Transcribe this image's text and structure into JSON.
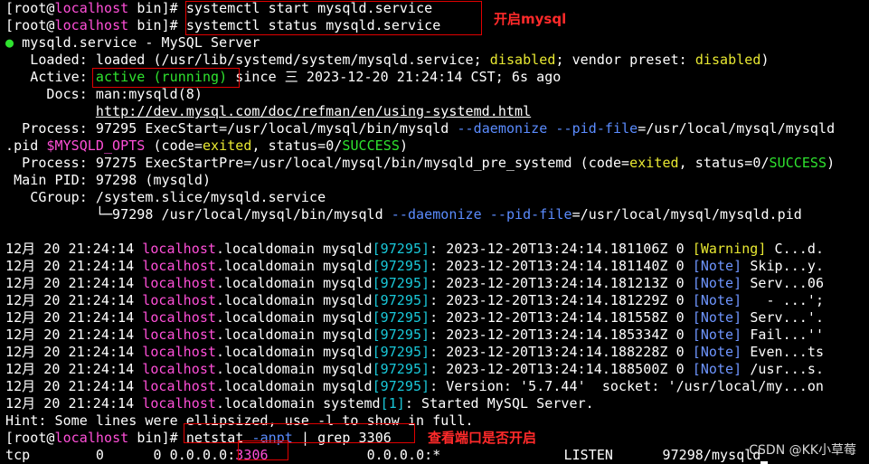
{
  "prompt": {
    "open": "[",
    "user": "root",
    "at": "@",
    "host": "localhost",
    "dir": " bin]",
    "hash": "# "
  },
  "cmd1": "systemctl start mysqld.service",
  "cmd2": "systemctl status mysqld.service",
  "status": {
    "bullet": "●",
    "title": " mysqld.service - MySQL Server",
    "loaded_label": "   Loaded: ",
    "loaded_pre": "loaded (/usr/lib/systemd/system/mysqld.service; ",
    "loaded_dis1": "disabled",
    "loaded_mid": "; vendor preset: ",
    "loaded_dis2": "disabled",
    "loaded_end": ")",
    "active_label": "   Active: ",
    "active_val": "active (running)",
    "active_since": " since 三 2023-12-20 21:24:14 CST; 6s ago",
    "docs_label": "     Docs: ",
    "docs_1": "man:mysqld(8)",
    "docs_indent": "           ",
    "docs_2": "http://dev.mysql.com/doc/refman/en/using-systemd.html",
    "proc1_a": "  Process: 97295 ExecStart=/usr/local/mysql/bin/mysqld ",
    "proc1_d": "--daemonize --pid-file",
    "proc1_b": "=/usr/local/mysql/mysqld",
    "proc1_c": ".pid ",
    "proc1_var": "$MYSQLD_OPTS",
    "proc1_code": " (code=",
    "proc1_exited": "exited",
    "proc1_st": ", status=0/",
    "proc1_succ": "SUCCESS",
    "proc1_end": ")",
    "proc2_a": "  Process: 97275 ExecStartPre=/usr/local/mysql/bin/mysqld_pre_systemd (code=",
    "proc2_exited": "exited",
    "proc2_st": ", status=0/",
    "proc2_succ": "SUCCESS",
    "proc2_end": ")",
    "mainpid": " Main PID: 97298 (mysqld)",
    "cgroup": "   CGroup: /system.slice/mysqld.service",
    "cgroup_tree_a": "           └─97298 /usr/local/mysql/bin/mysqld ",
    "cgroup_tree_d1": "--daemonize",
    "cgroup_tree_sp": " ",
    "cgroup_tree_d2": "--pid-file",
    "cgroup_tree_b": "=/usr/local/mysql/mysqld.pid"
  },
  "logs": [
    {
      "date": "12月 20 21:24:14 ",
      "host": "localhost",
      ".domain": ".localdomain",
      "proc": " mysqld",
      "pid": "[97295]",
      "msg": ": 2023-12-20T13:24:14.181106Z 0 ",
      "tag": "[Warning]",
      "tail": " C...d."
    },
    {
      "date": "12月 20 21:24:14 ",
      "host": "localhost",
      "proc": " mysqld",
      "pid": "[97295]",
      "msg": ": 2023-12-20T13:24:14.181140Z 0 ",
      "tag": "[Note]",
      "tail": " Skip...y."
    },
    {
      "date": "12月 20 21:24:14 ",
      "host": "localhost",
      "proc": " mysqld",
      "pid": "[97295]",
      "msg": ": 2023-12-20T13:24:14.181213Z 0 ",
      "tag": "[Note]",
      "tail": " Serv...06"
    },
    {
      "date": "12月 20 21:24:14 ",
      "host": "localhost",
      "proc": " mysqld",
      "pid": "[97295]",
      "msg": ": 2023-12-20T13:24:14.181229Z 0 ",
      "tag": "[Note]",
      "tail": "   - ...';"
    },
    {
      "date": "12月 20 21:24:14 ",
      "host": "localhost",
      "proc": " mysqld",
      "pid": "[97295]",
      "msg": ": 2023-12-20T13:24:14.181558Z 0 ",
      "tag": "[Note]",
      "tail": " Serv...'."
    },
    {
      "date": "12月 20 21:24:14 ",
      "host": "localhost",
      "proc": " mysqld",
      "pid": "[97295]",
      "msg": ": 2023-12-20T13:24:14.185334Z 0 ",
      "tag": "[Note]",
      "tail": " Fail...''"
    },
    {
      "date": "12月 20 21:24:14 ",
      "host": "localhost",
      "proc": " mysqld",
      "pid": "[97295]",
      "msg": ": 2023-12-20T13:24:14.188228Z 0 ",
      "tag": "[Note]",
      "tail": " Even...ts"
    },
    {
      "date": "12月 20 21:24:14 ",
      "host": "localhost",
      "proc": " mysqld",
      "pid": "[97295]",
      "msg": ": 2023-12-20T13:24:14.188500Z 0 ",
      "tag": "[Note]",
      "tail": " /usr...s."
    }
  ],
  "log_version": {
    "date": "12月 20 21:24:14 ",
    "host": "localhost",
    "domain": ".localdomain",
    "proc": " mysqld",
    "pid": "[97295]",
    "msg": ": Version: '5.7.44'  socket: '/usr/local/my...on"
  },
  "log_started": {
    "date": "12月 20 21:24:14 ",
    "host": "localhost",
    "domain": ".localdomain",
    "proc": " systemd",
    "pid": "[1]",
    "msg": ": Started MySQL Server."
  },
  "hint": "Hint: Some lines were ellipsized, use -l to show in full.",
  "cmd3": {
    "a": "netstat ",
    "b": "-anpt",
    "c": " | grep 3306"
  },
  "netstat_row": {
    "proto": "tcp",
    "a": "        0      0 0.0.0.0:",
    "port": "3306",
    "b": "            0.0.0.0:*               LISTEN      97298/mysqld"
  },
  "annotations": {
    "open_mysql": "开启mysql",
    "check_port": "查看端口是否开启"
  },
  "watermark": "CSDN @KK小草莓",
  "colors": {
    "background": "#000000",
    "prompt_host": "#ff4fd8",
    "active_green": "#2fe32f",
    "disabled_yellow": "#e8e832",
    "option_blue": "#5b8cff",
    "pid_cyan": "#19c7d8",
    "annotation_red": "#ff2a2a"
  }
}
